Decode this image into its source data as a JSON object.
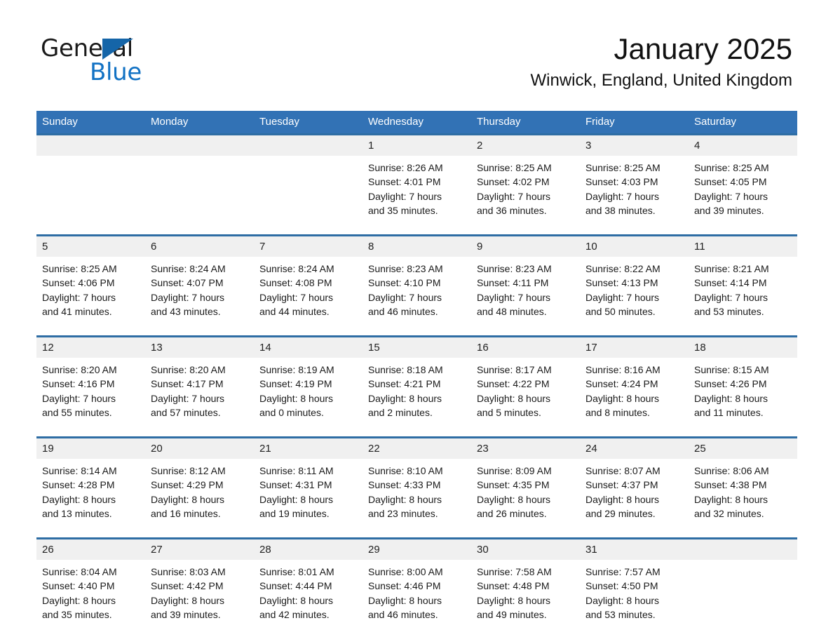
{
  "logo": {
    "word1": "General",
    "word2": "Blue",
    "triangle_color": "#1565a8",
    "blue_color": "#1272c4"
  },
  "header": {
    "title": "January 2025",
    "subtitle": "Winwick, England, United Kingdom"
  },
  "colors": {
    "header_bar": "#3272b5",
    "row_rule": "#2e6da4",
    "daynum_bg": "#f0f0f0"
  },
  "weekday_headers": [
    "Sunday",
    "Monday",
    "Tuesday",
    "Wednesday",
    "Thursday",
    "Friday",
    "Saturday"
  ],
  "weeks": [
    [
      {
        "day": "",
        "lines": []
      },
      {
        "day": "",
        "lines": []
      },
      {
        "day": "",
        "lines": []
      },
      {
        "day": "1",
        "lines": [
          "Sunrise: 8:26 AM",
          "Sunset: 4:01 PM",
          "Daylight: 7 hours",
          "and 35 minutes."
        ]
      },
      {
        "day": "2",
        "lines": [
          "Sunrise: 8:25 AM",
          "Sunset: 4:02 PM",
          "Daylight: 7 hours",
          "and 36 minutes."
        ]
      },
      {
        "day": "3",
        "lines": [
          "Sunrise: 8:25 AM",
          "Sunset: 4:03 PM",
          "Daylight: 7 hours",
          "and 38 minutes."
        ]
      },
      {
        "day": "4",
        "lines": [
          "Sunrise: 8:25 AM",
          "Sunset: 4:05 PM",
          "Daylight: 7 hours",
          "and 39 minutes."
        ]
      }
    ],
    [
      {
        "day": "5",
        "lines": [
          "Sunrise: 8:25 AM",
          "Sunset: 4:06 PM",
          "Daylight: 7 hours",
          "and 41 minutes."
        ]
      },
      {
        "day": "6",
        "lines": [
          "Sunrise: 8:24 AM",
          "Sunset: 4:07 PM",
          "Daylight: 7 hours",
          "and 43 minutes."
        ]
      },
      {
        "day": "7",
        "lines": [
          "Sunrise: 8:24 AM",
          "Sunset: 4:08 PM",
          "Daylight: 7 hours",
          "and 44 minutes."
        ]
      },
      {
        "day": "8",
        "lines": [
          "Sunrise: 8:23 AM",
          "Sunset: 4:10 PM",
          "Daylight: 7 hours",
          "and 46 minutes."
        ]
      },
      {
        "day": "9",
        "lines": [
          "Sunrise: 8:23 AM",
          "Sunset: 4:11 PM",
          "Daylight: 7 hours",
          "and 48 minutes."
        ]
      },
      {
        "day": "10",
        "lines": [
          "Sunrise: 8:22 AM",
          "Sunset: 4:13 PM",
          "Daylight: 7 hours",
          "and 50 minutes."
        ]
      },
      {
        "day": "11",
        "lines": [
          "Sunrise: 8:21 AM",
          "Sunset: 4:14 PM",
          "Daylight: 7 hours",
          "and 53 minutes."
        ]
      }
    ],
    [
      {
        "day": "12",
        "lines": [
          "Sunrise: 8:20 AM",
          "Sunset: 4:16 PM",
          "Daylight: 7 hours",
          "and 55 minutes."
        ]
      },
      {
        "day": "13",
        "lines": [
          "Sunrise: 8:20 AM",
          "Sunset: 4:17 PM",
          "Daylight: 7 hours",
          "and 57 minutes."
        ]
      },
      {
        "day": "14",
        "lines": [
          "Sunrise: 8:19 AM",
          "Sunset: 4:19 PM",
          "Daylight: 8 hours",
          "and 0 minutes."
        ]
      },
      {
        "day": "15",
        "lines": [
          "Sunrise: 8:18 AM",
          "Sunset: 4:21 PM",
          "Daylight: 8 hours",
          "and 2 minutes."
        ]
      },
      {
        "day": "16",
        "lines": [
          "Sunrise: 8:17 AM",
          "Sunset: 4:22 PM",
          "Daylight: 8 hours",
          "and 5 minutes."
        ]
      },
      {
        "day": "17",
        "lines": [
          "Sunrise: 8:16 AM",
          "Sunset: 4:24 PM",
          "Daylight: 8 hours",
          "and 8 minutes."
        ]
      },
      {
        "day": "18",
        "lines": [
          "Sunrise: 8:15 AM",
          "Sunset: 4:26 PM",
          "Daylight: 8 hours",
          "and 11 minutes."
        ]
      }
    ],
    [
      {
        "day": "19",
        "lines": [
          "Sunrise: 8:14 AM",
          "Sunset: 4:28 PM",
          "Daylight: 8 hours",
          "and 13 minutes."
        ]
      },
      {
        "day": "20",
        "lines": [
          "Sunrise: 8:12 AM",
          "Sunset: 4:29 PM",
          "Daylight: 8 hours",
          "and 16 minutes."
        ]
      },
      {
        "day": "21",
        "lines": [
          "Sunrise: 8:11 AM",
          "Sunset: 4:31 PM",
          "Daylight: 8 hours",
          "and 19 minutes."
        ]
      },
      {
        "day": "22",
        "lines": [
          "Sunrise: 8:10 AM",
          "Sunset: 4:33 PM",
          "Daylight: 8 hours",
          "and 23 minutes."
        ]
      },
      {
        "day": "23",
        "lines": [
          "Sunrise: 8:09 AM",
          "Sunset: 4:35 PM",
          "Daylight: 8 hours",
          "and 26 minutes."
        ]
      },
      {
        "day": "24",
        "lines": [
          "Sunrise: 8:07 AM",
          "Sunset: 4:37 PM",
          "Daylight: 8 hours",
          "and 29 minutes."
        ]
      },
      {
        "day": "25",
        "lines": [
          "Sunrise: 8:06 AM",
          "Sunset: 4:38 PM",
          "Daylight: 8 hours",
          "and 32 minutes."
        ]
      }
    ],
    [
      {
        "day": "26",
        "lines": [
          "Sunrise: 8:04 AM",
          "Sunset: 4:40 PM",
          "Daylight: 8 hours",
          "and 35 minutes."
        ]
      },
      {
        "day": "27",
        "lines": [
          "Sunrise: 8:03 AM",
          "Sunset: 4:42 PM",
          "Daylight: 8 hours",
          "and 39 minutes."
        ]
      },
      {
        "day": "28",
        "lines": [
          "Sunrise: 8:01 AM",
          "Sunset: 4:44 PM",
          "Daylight: 8 hours",
          "and 42 minutes."
        ]
      },
      {
        "day": "29",
        "lines": [
          "Sunrise: 8:00 AM",
          "Sunset: 4:46 PM",
          "Daylight: 8 hours",
          "and 46 minutes."
        ]
      },
      {
        "day": "30",
        "lines": [
          "Sunrise: 7:58 AM",
          "Sunset: 4:48 PM",
          "Daylight: 8 hours",
          "and 49 minutes."
        ]
      },
      {
        "day": "31",
        "lines": [
          "Sunrise: 7:57 AM",
          "Sunset: 4:50 PM",
          "Daylight: 8 hours",
          "and 53 minutes."
        ]
      },
      {
        "day": "",
        "lines": []
      }
    ]
  ]
}
